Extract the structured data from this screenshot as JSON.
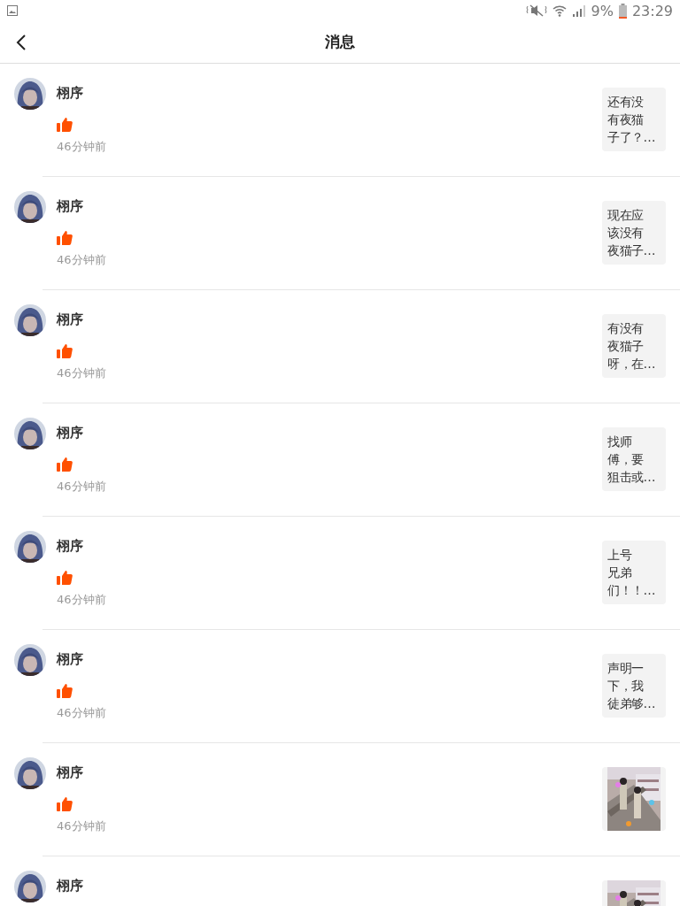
{
  "status_bar": {
    "battery": "9%",
    "time": "23:29"
  },
  "header": {
    "title": "消息"
  },
  "messages": [
    {
      "name": "栩序",
      "kind": "like",
      "time": "46分钟前",
      "preview": {
        "kind": "text",
        "lines": [
          "还有没",
          "有夜猫",
          "子了？…"
        ]
      }
    },
    {
      "name": "栩序",
      "kind": "like",
      "time": "46分钟前",
      "preview": {
        "kind": "text",
        "lines": [
          "现在应",
          "该没有",
          "夜猫子…"
        ]
      }
    },
    {
      "name": "栩序",
      "kind": "like",
      "time": "46分钟前",
      "preview": {
        "kind": "text",
        "lines": [
          "有没有",
          "夜猫子",
          "呀，在…"
        ]
      }
    },
    {
      "name": "栩序",
      "kind": "like",
      "time": "46分钟前",
      "preview": {
        "kind": "text",
        "lines": [
          "找师",
          "傅，要",
          "狙击或…"
        ]
      }
    },
    {
      "name": "栩序",
      "kind": "like",
      "time": "46分钟前",
      "preview": {
        "kind": "text",
        "lines": [
          "上号",
          "兄弟",
          "们！！…"
        ]
      }
    },
    {
      "name": "栩序",
      "kind": "like",
      "time": "46分钟前",
      "preview": {
        "kind": "text",
        "lines": [
          "声明一",
          "下，我",
          "徒弟够…"
        ]
      }
    },
    {
      "name": "栩序",
      "kind": "like",
      "time": "46分钟前"
    },
    {
      "name": "栩序"
    }
  ]
}
